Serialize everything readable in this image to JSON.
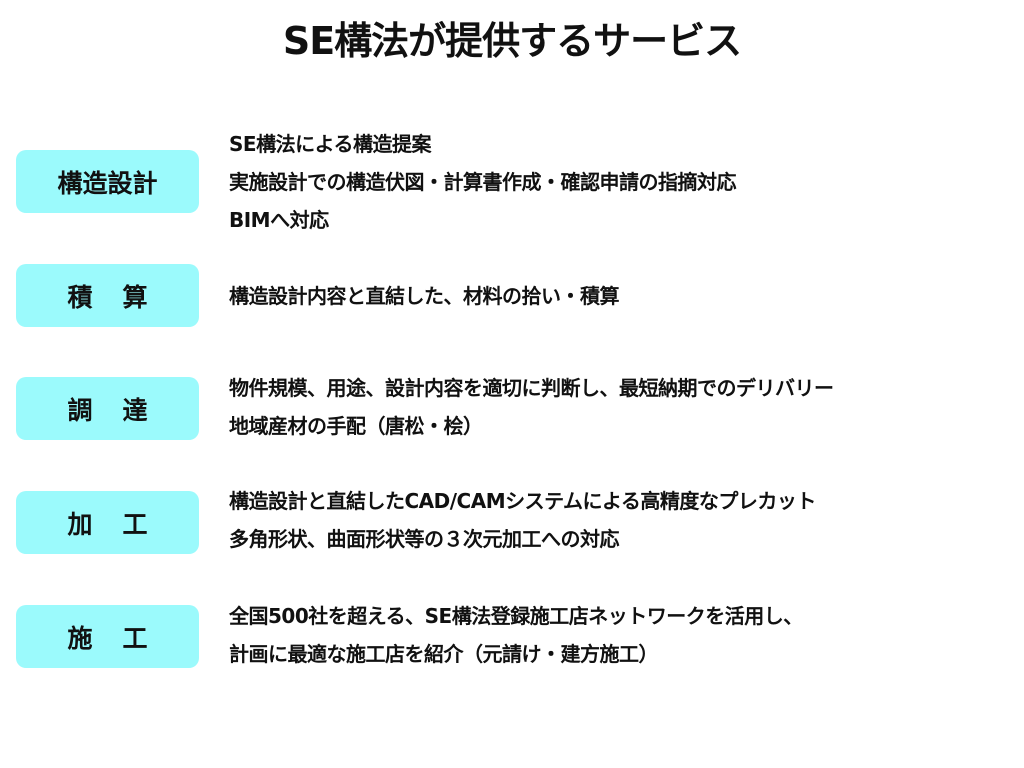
{
  "title": "SE構法が提供するサービス",
  "accent_color": "#9bfafc",
  "services": [
    {
      "label_parts": [
        "構造設計",
        ""
      ],
      "lines": [
        "SE構法による構造提案",
        "実施設計での構造伏図・計算書作成・確認申請の指摘対応",
        "BIMへ対応"
      ]
    },
    {
      "label_parts": [
        "積",
        "算"
      ],
      "lines": [
        "構造設計内容と直結した、材料の拾い・積算"
      ]
    },
    {
      "label_parts": [
        "調",
        "達"
      ],
      "lines": [
        "物件規模、用途、設計内容を適切に判断し、最短納期でのデリバリー",
        "地域産材の手配（唐松・桧）"
      ]
    },
    {
      "label_parts": [
        "加",
        "工"
      ],
      "lines": [
        "構造設計と直結したCAD/CAMシステムによる高精度なプレカット",
        "多角形状、曲面形状等の３次元加工への対応"
      ]
    },
    {
      "label_parts": [
        "施",
        "工"
      ],
      "lines": [
        "全国500社を超える、SE構法登録施工店ネットワークを活用し、",
        "計画に最適な施工店を紹介（元請け・建方施工）"
      ]
    }
  ]
}
